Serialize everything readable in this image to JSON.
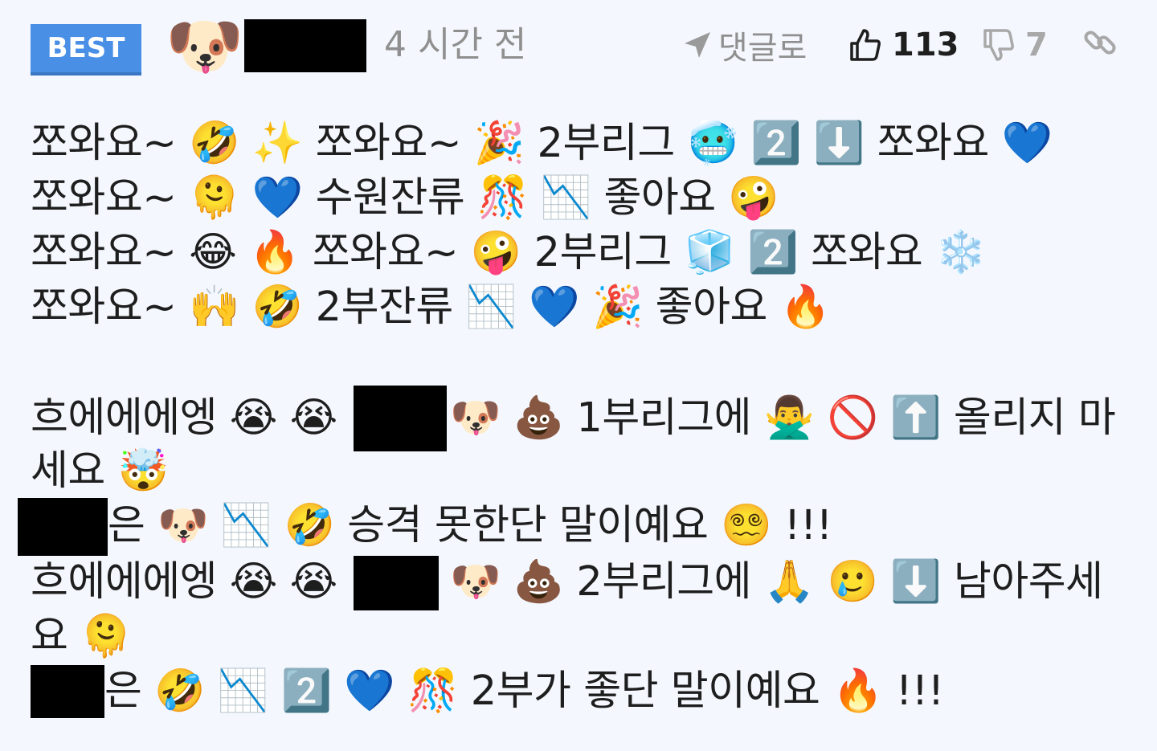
{
  "header": {
    "badge": "BEST",
    "avatar_emoji": "🐶",
    "timestamp": "4 시간 전",
    "reply_label": "댓글로",
    "like_count": "113",
    "dislike_count": "7",
    "icons": [
      "send-icon",
      "thumbs-up-icon",
      "thumbs-down-icon",
      "link-icon"
    ]
  },
  "comment": {
    "lines": [
      "쪼와요~ 🤣 ✨ 쪼와요~ 🎉 2부리그 🥶 2️⃣ ⬇️ 쪼와요 💙",
      "쪼와요~ 🫠 💙 수원잔류 🎊 📉 좋아요 🤪",
      "쪼와요~ 😂 🔥 쪼와요~ 🤪 2부리그 🧊 2️⃣ 쪼와요 ❄️",
      "쪼와요~ 🙌 🤣 2부잔류 📉 💙 🎉 좋아요 🔥",
      "흐에에에엥 😭 😭",
      "🐶 💩 1부리그에 🙅‍♂️ 🚫 ⬆️ 올리지 마",
      "세요 🤯",
      "은 🐶 📉 🤣 승격 못한단 말이예요 😵‍💫 !!!",
      "흐에에에엥 😭 😭",
      "🐶 💩 2부리그에 🙏 🥲 ⬇️ 남아주세",
      "요 🫠",
      "은 🤣 📉 2️⃣ 💙 🎊 2부가 좋단 말이예요 🔥 !!!"
    ]
  }
}
